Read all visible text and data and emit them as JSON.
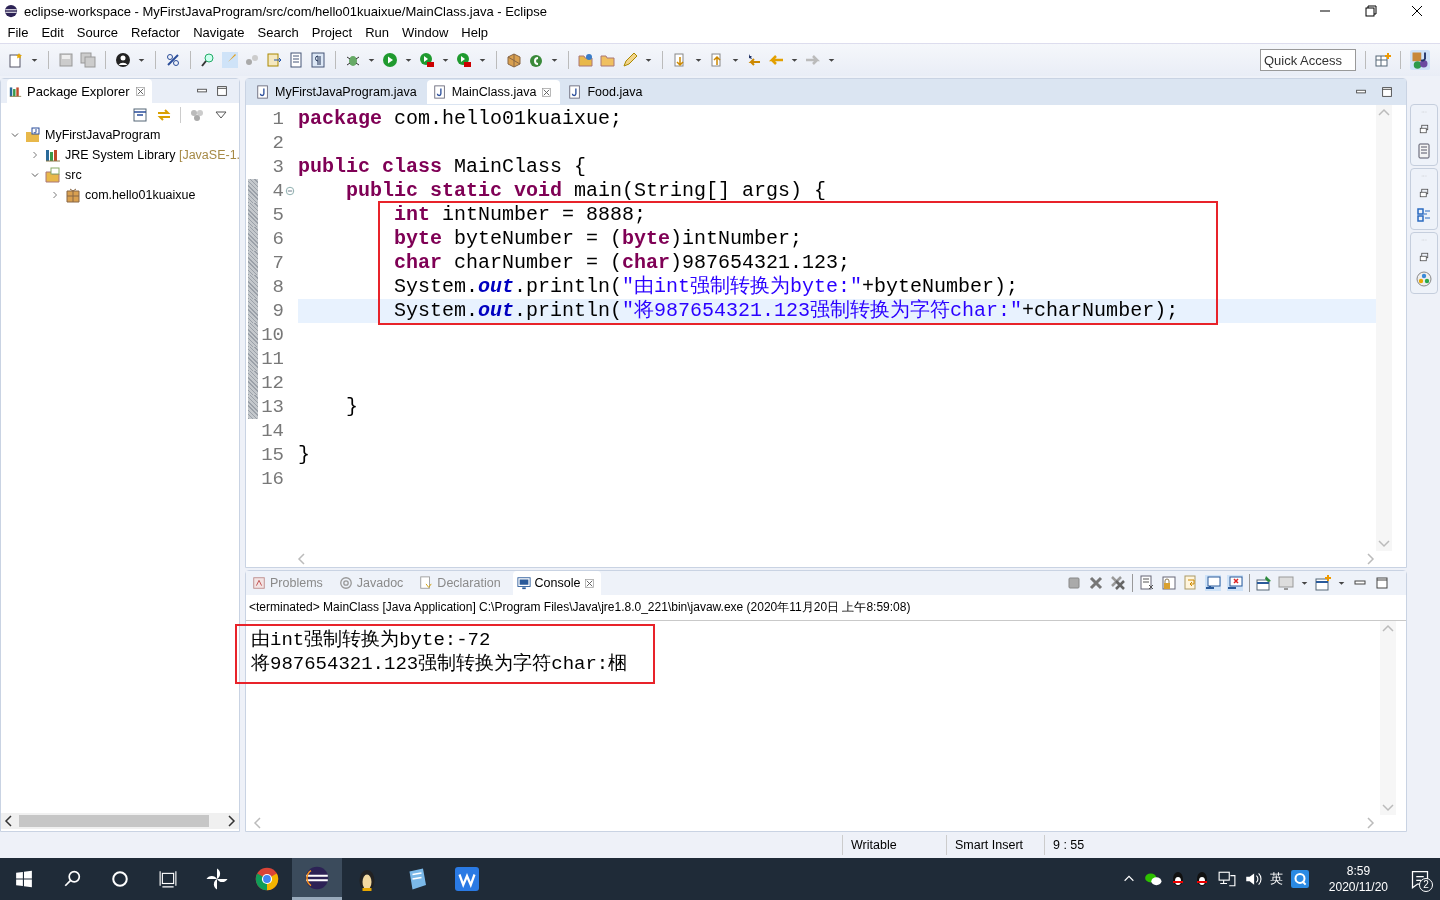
{
  "window": {
    "title": "eclipse-workspace - MyFirstJavaProgram/src/com/hello01kuaixue/MainClass.java - Eclipse"
  },
  "menu": [
    "File",
    "Edit",
    "Source",
    "Refactor",
    "Navigate",
    "Search",
    "Project",
    "Run",
    "Window",
    "Help"
  ],
  "quick_access": {
    "placeholder": "Quick Access"
  },
  "package_explorer": {
    "title": "Package Explorer",
    "tree": [
      {
        "label": "MyFirstJavaProgram",
        "kind": "project",
        "expanded": true,
        "children": [
          {
            "label": "JRE System Library",
            "detail": "[JavaSE-1.",
            "kind": "library",
            "expanded": false
          },
          {
            "label": "src",
            "kind": "folder",
            "expanded": true,
            "children": [
              {
                "label": "com.hello01kuaixue",
                "kind": "package",
                "expanded": false
              }
            ]
          }
        ]
      }
    ]
  },
  "editor": {
    "tabs": [
      {
        "label": "MyFirstJavaProgram.java",
        "selected": false
      },
      {
        "label": "MainClass.java",
        "selected": true
      },
      {
        "label": "Food.java",
        "selected": false
      }
    ],
    "lines": [
      {
        "number": "1",
        "tokens": [
          {
            "kind": "keyword",
            "text": "package"
          },
          {
            "kind": "plain",
            "text": " com.hello01kuaixue;"
          }
        ]
      },
      {
        "number": "2"
      },
      {
        "number": "3",
        "tokens": [
          {
            "kind": "keyword",
            "text": "public class"
          },
          {
            "kind": "plain",
            "text": " MainClass {"
          }
        ],
        "children": [
          {
            "number": "4",
            "foldable": true,
            "range_marked": true,
            "tokens": [
              {
                "kind": "keyword",
                "text": "public static void"
              },
              {
                "kind": "plain",
                "text": " main(String[] args) {"
              }
            ],
            "children": [
              {
                "number": "5",
                "range_marked": true,
                "boxed": true,
                "tokens": [
                  {
                    "kind": "keyword",
                    "text": "int"
                  },
                  {
                    "kind": "plain",
                    "text": " intNumber = 8888;"
                  }
                ]
              },
              {
                "number": "6",
                "range_marked": true,
                "boxed": true,
                "tokens": [
                  {
                    "kind": "keyword",
                    "text": "byte"
                  },
                  {
                    "kind": "plain",
                    "text": " byteNumber = ("
                  },
                  {
                    "kind": "keyword",
                    "text": "byte"
                  },
                  {
                    "kind": "plain",
                    "text": ")intNumber;"
                  }
                ]
              },
              {
                "number": "7",
                "range_marked": true,
                "boxed": true,
                "tokens": [
                  {
                    "kind": "keyword",
                    "text": "char"
                  },
                  {
                    "kind": "plain",
                    "text": " charNumber = ("
                  },
                  {
                    "kind": "keyword",
                    "text": "char"
                  },
                  {
                    "kind": "plain",
                    "text": ")987654321.123;"
                  }
                ]
              },
              {
                "number": "8",
                "range_marked": true,
                "boxed": true,
                "tokens": [
                  {
                    "kind": "plain",
                    "text": "System."
                  },
                  {
                    "kind": "field",
                    "text": "out"
                  },
                  {
                    "kind": "plain",
                    "text": ".println("
                  },
                  {
                    "kind": "string",
                    "text": "\"由int强制转换为byte:\""
                  },
                  {
                    "kind": "plain",
                    "text": "+byteNumber);"
                  }
                ]
              },
              {
                "number": "9",
                "range_marked": true,
                "boxed": true,
                "current": true,
                "tokens": [
                  {
                    "kind": "plain",
                    "text": "System."
                  },
                  {
                    "kind": "field",
                    "text": "out"
                  },
                  {
                    "kind": "plain",
                    "text": ".println("
                  },
                  {
                    "kind": "string",
                    "text": "\"将987654321.123强制转换为字符char:\""
                  },
                  {
                    "kind": "plain",
                    "text": "+charNumber);"
                  }
                ]
              },
              {
                "number": "10",
                "range_marked": true
              },
              {
                "number": "11",
                "range_marked": true
              },
              {
                "number": "12",
                "range_marked": true
              }
            ]
          },
          {
            "number": "13",
            "range_marked": true,
            "tokens": [
              {
                "kind": "plain",
                "text": "}"
              }
            ]
          }
        ]
      },
      {
        "number": "14"
      },
      {
        "number": "15",
        "tokens": [
          {
            "kind": "plain",
            "text": "}"
          }
        ]
      },
      {
        "number": "16"
      }
    ]
  },
  "console": {
    "tabs": [
      {
        "label": "Problems",
        "selected": false
      },
      {
        "label": "Javadoc",
        "selected": false
      },
      {
        "label": "Declaration",
        "selected": false
      },
      {
        "label": "Console",
        "selected": true
      }
    ],
    "description": "<terminated> MainClass [Java Application] C:\\Program Files\\Java\\jre1.8.0_221\\bin\\javaw.exe (2020年11月20日 上午8:59:08)",
    "boxed": true,
    "output": [
      "由int强制转换为byte:-72",
      "将987654321.123强制转换为字符char:梱"
    ]
  },
  "status_bar": [
    "Writable",
    "Smart Insert",
    "9 : 55"
  ],
  "taskbar": {
    "apps": [
      {
        "kind": "pinwheel",
        "active": false
      },
      {
        "kind": "chrome",
        "active": false
      },
      {
        "kind": "eclipse",
        "active": true
      },
      {
        "kind": "penguin",
        "active": false
      },
      {
        "kind": "notebook",
        "active": false
      },
      {
        "kind": "wps",
        "active": false
      }
    ],
    "input_method": "英",
    "time": "8:59",
    "date": "2020/11/20",
    "notification_count": "2"
  }
}
